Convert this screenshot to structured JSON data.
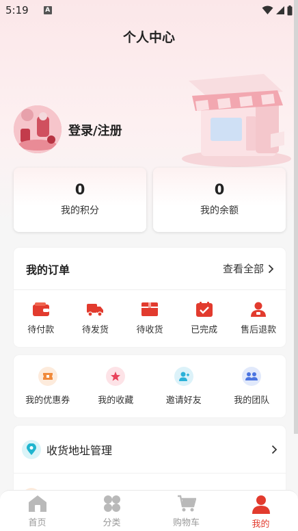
{
  "status_bar": {
    "time": "5:19",
    "notification_badge": "A"
  },
  "header": {
    "title": "个人中心"
  },
  "profile": {
    "login_label": "登录/注册"
  },
  "stats": [
    {
      "value": "0",
      "label": "我的积分"
    },
    {
      "value": "0",
      "label": "我的余额"
    }
  ],
  "orders": {
    "title": "我的订单",
    "view_all": "查看全部",
    "items": [
      {
        "label": "待付款",
        "icon": "wallet-icon"
      },
      {
        "label": "待发货",
        "icon": "truck-icon"
      },
      {
        "label": "待收货",
        "icon": "package-icon"
      },
      {
        "label": "已完成",
        "icon": "check-clipboard-icon"
      },
      {
        "label": "售后退款",
        "icon": "user-service-icon"
      }
    ]
  },
  "services": [
    {
      "label": "我的优惠券",
      "icon": "coupon-icon",
      "color": "#f08a3c"
    },
    {
      "label": "我的收藏",
      "icon": "star-icon",
      "color": "#e8435b"
    },
    {
      "label": "邀请好友",
      "icon": "invite-user-icon",
      "color": "#2bb1d8"
    },
    {
      "label": "我的团队",
      "icon": "team-icon",
      "color": "#4a74e0"
    }
  ],
  "menu": [
    {
      "label": "收货地址管理",
      "icon": "location-pin-icon"
    }
  ],
  "tabbar": [
    {
      "label": "首页",
      "icon": "home-icon"
    },
    {
      "label": "分类",
      "icon": "category-icon"
    },
    {
      "label": "购物车",
      "icon": "cart-icon"
    },
    {
      "label": "我的",
      "icon": "person-icon",
      "active": true
    }
  ],
  "colors": {
    "accent": "#e23b2e",
    "brand_pink": "#fbe7e9"
  }
}
